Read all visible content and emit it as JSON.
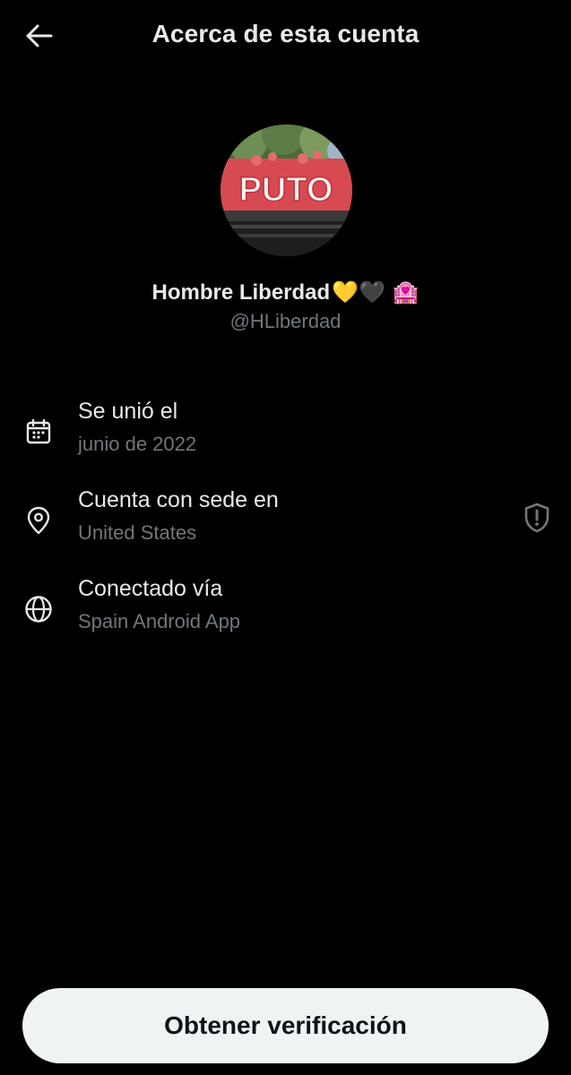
{
  "header": {
    "title": "Acerca de esta cuenta"
  },
  "profile": {
    "name": "Hombre Liberdad",
    "name_emojis": "💛🖤 🏩",
    "handle": "@HLiberdad",
    "avatar_sign_text": "PUTO"
  },
  "details": [
    {
      "icon": "calendar-icon",
      "label": "Se unió el",
      "value": "junio de 2022"
    },
    {
      "icon": "location-pin-icon",
      "label": "Cuenta con sede en",
      "value": "United States"
    },
    {
      "icon": "globe-icon",
      "label": "Conectado vía",
      "value": "Spain Android App"
    }
  ],
  "actions": {
    "verify_label": "Obtener verificación"
  },
  "colors": {
    "background": "#000000",
    "primary_text": "#e7e9ea",
    "secondary_text": "#71767b",
    "button_bg": "#eff3f4",
    "button_text": "#0f1419"
  }
}
